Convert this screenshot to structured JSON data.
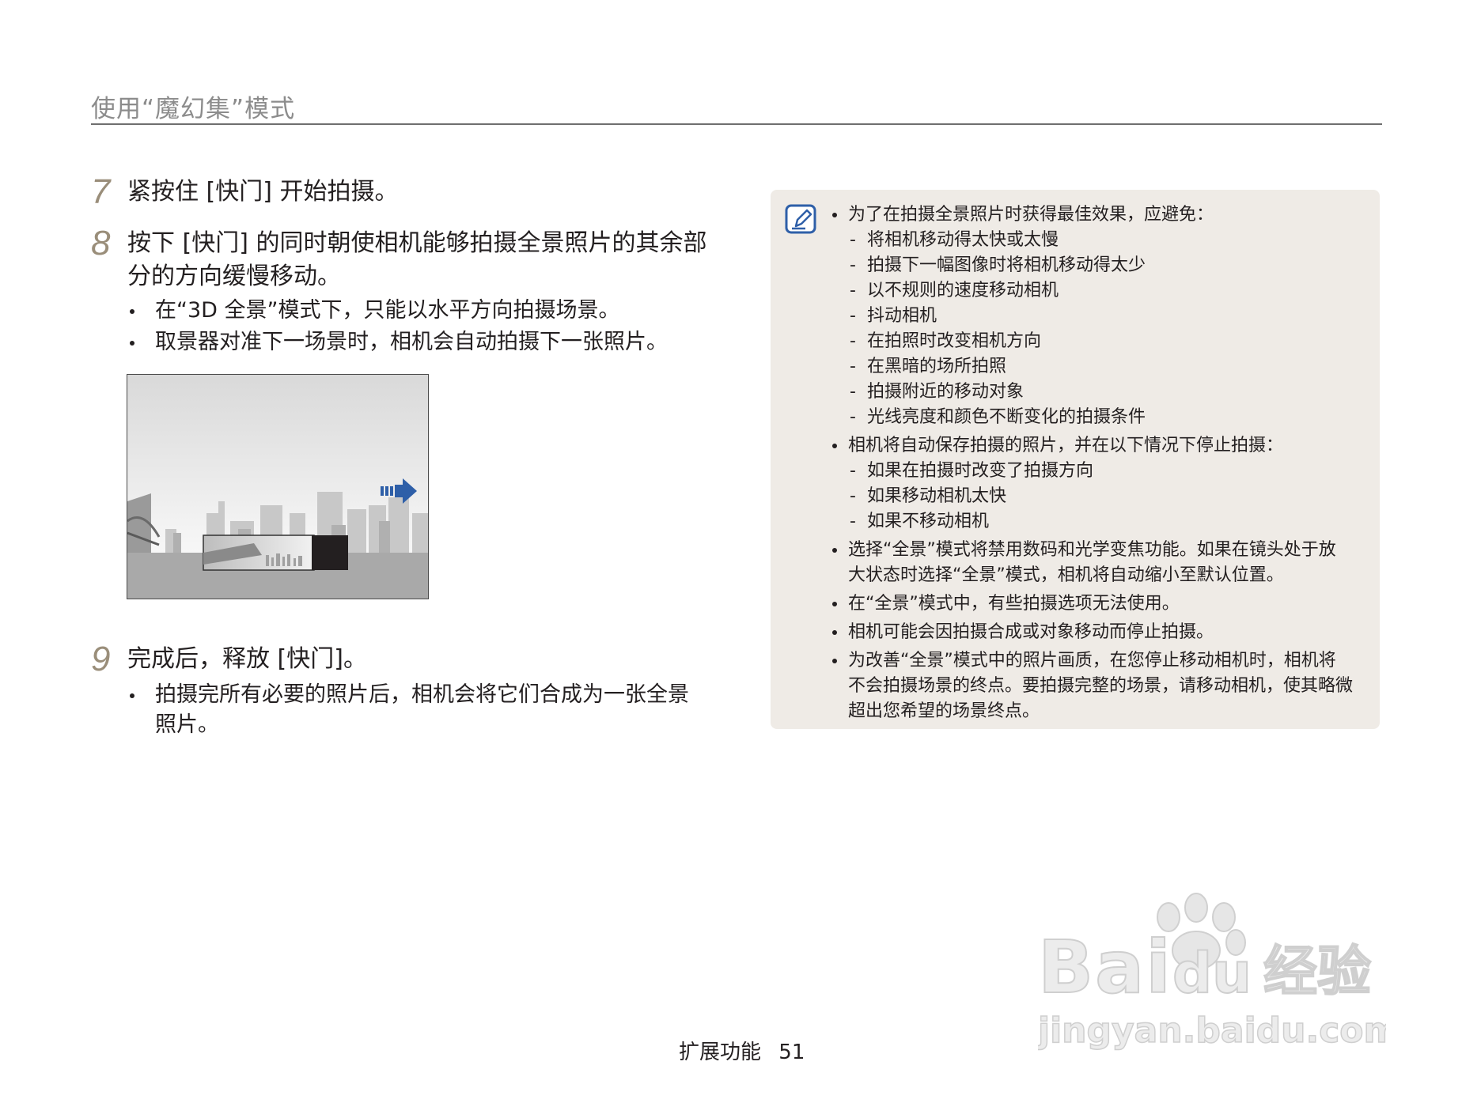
{
  "header": {
    "title": "使用“魔幻集”模式"
  },
  "steps": [
    {
      "num": "7",
      "text": "紧按住 [快门] 开始拍摄。"
    },
    {
      "num": "8",
      "text_line1": "按下 [快门] 的同时朝使相机能够拍摄全景照片的其余部",
      "text_line2": "分的方向缓慢移动。",
      "bullets": [
        "在“3D 全景”模式下，只能以水平方向拍摄场景。",
        "取景器对准下一场景时，相机会自动拍摄下一张照片。"
      ]
    },
    {
      "num": "9",
      "text": "完成后，释放 [快门]。",
      "bullets_line1": "拍摄完所有必要的照片后，相机会将它们合成为一张全景",
      "bullets_line2": "照片。"
    }
  ],
  "note": {
    "items": [
      {
        "text": "为了在拍摄全景照片时获得最佳效果，应避免：",
        "subs": [
          "将相机移动得太快或太慢",
          "拍摄下一幅图像时将相机移动得太少",
          "以不规则的速度移动相机",
          "抖动相机",
          "在拍照时改变相机方向",
          "在黑暗的场所拍照",
          "拍摄附近的移动对象",
          "光线亮度和颜色不断变化的拍摄条件"
        ]
      },
      {
        "text": "相机将自动保存拍摄的照片，并在以下情况下停止拍摄：",
        "subs": [
          "如果在拍摄时改变了拍摄方向",
          "如果移动相机太快",
          "如果不移动相机"
        ]
      },
      {
        "text_line1": "选择“全景”模式将禁用数码和光学变焦功能。如果在镜头处于放",
        "text_line2": "大状态时选择“全景”模式，相机将自动缩小至默认位置。"
      },
      {
        "text": "在“全景”模式中，有些拍摄选项无法使用。"
      },
      {
        "text": "相机可能会因拍摄合成或对象移动而停止拍摄。"
      },
      {
        "text_line1": "为改善“全景”模式中的照片画质，在您停止移动相机时，相机将",
        "text_line2": "不会拍摄场景的终点。要拍摄完整的场景，请移动相机，使其略微",
        "text_line3": "超出您希望的场景终点。"
      }
    ],
    "icon": "note-pencil-icon"
  },
  "footer": {
    "label": "扩展功能",
    "page": "51"
  },
  "watermark": {
    "brand": "Bai du 经验",
    "url": "jingyan.baidu.com"
  },
  "colors": {
    "accent_num": "#9a8e7a",
    "note_bg": "#efebe6",
    "arrow": "#2e5fa8"
  }
}
